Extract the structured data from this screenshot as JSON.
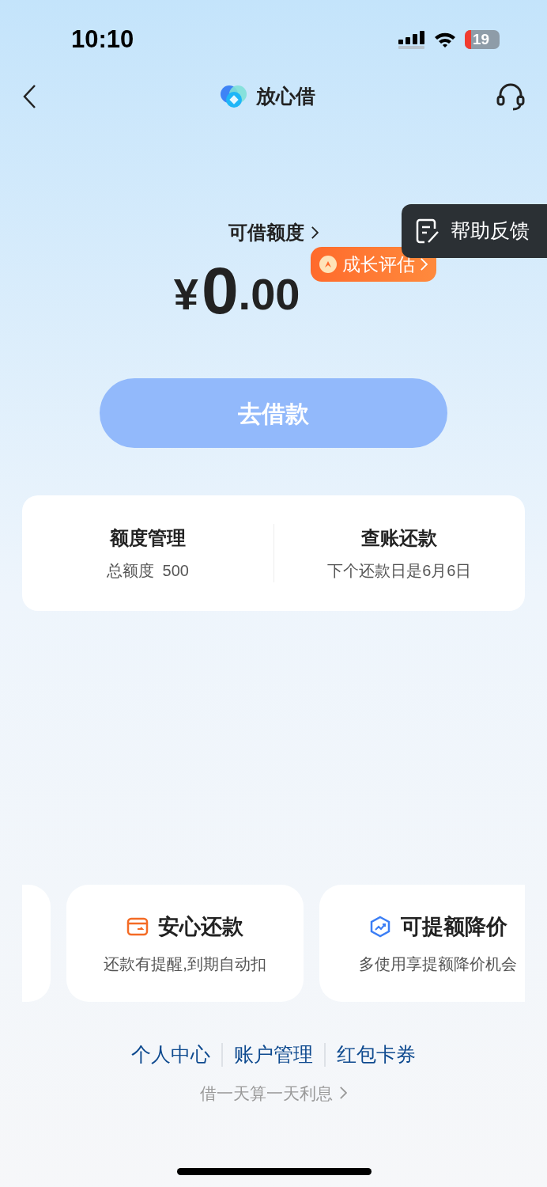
{
  "status_bar": {
    "time": "10:10",
    "battery": "19"
  },
  "nav": {
    "title": "放心借"
  },
  "help": {
    "label": "帮助反馈"
  },
  "credit": {
    "label": "可借额度",
    "currency": "¥",
    "integer": "0",
    "decimal": ".00",
    "badge": "成长评估"
  },
  "borrow_button": {
    "label": "去借款",
    "disabled": true
  },
  "summary": [
    {
      "title": "额度管理",
      "subtitle": "总额度  500"
    },
    {
      "title": "查账还款",
      "subtitle": "下个还款日是6月6日"
    }
  ],
  "features": [
    {
      "kind": "repay",
      "title": "安心还款",
      "subtitle": "还款有提醒,到期自动扣"
    },
    {
      "kind": "boost",
      "title": "可提额降价",
      "subtitle": "多使用享提额降价机会"
    }
  ],
  "links": [
    "个人中心",
    "账户管理",
    "红包卡券"
  ],
  "footer": "借一天算一天利息"
}
